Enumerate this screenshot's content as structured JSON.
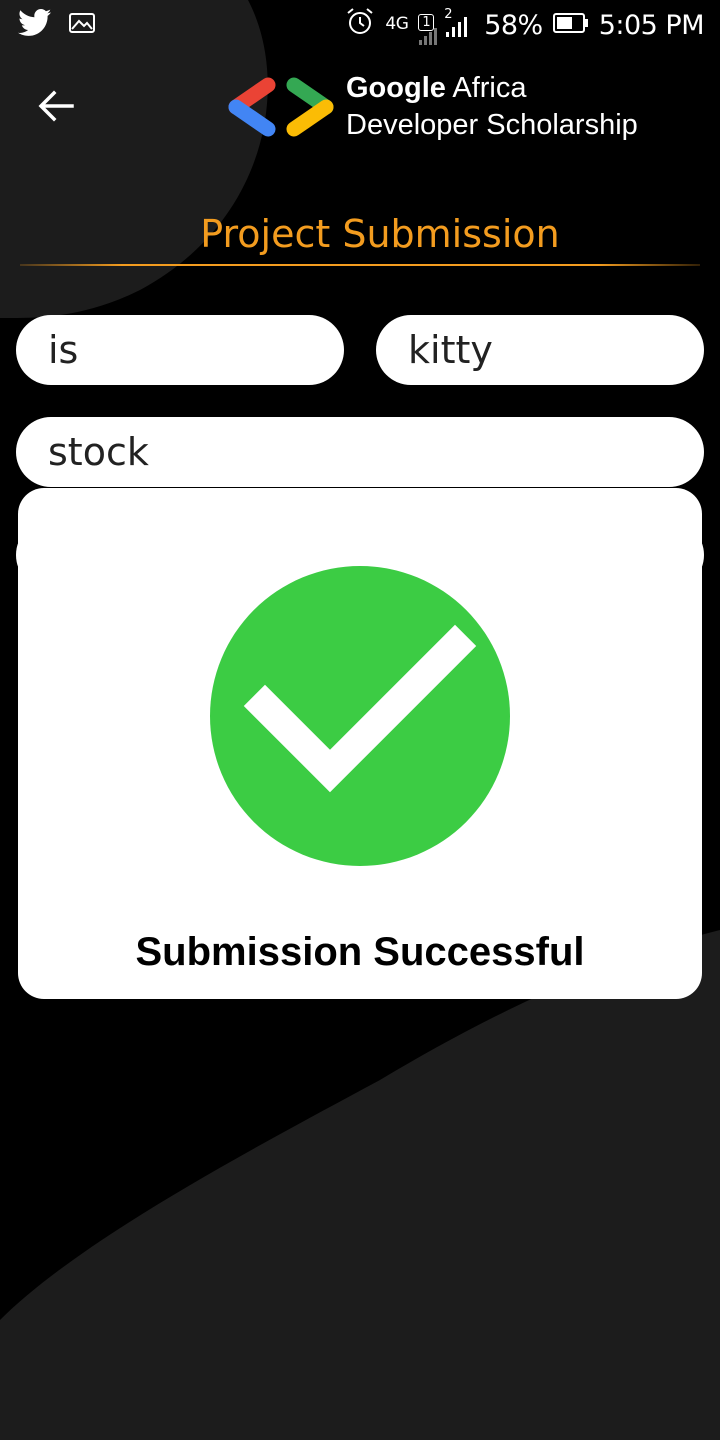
{
  "status_bar": {
    "network_type": "4G",
    "sim1": "1",
    "sim2": "2",
    "battery_percent": "58%",
    "time": "5:05 PM",
    "icons": [
      "twitter-icon",
      "gallery-icon",
      "alarm-icon",
      "signal-icon",
      "battery-icon"
    ]
  },
  "header": {
    "logo_brand": "Google",
    "logo_word2": "Africa",
    "logo_line2": "Developer Scholarship",
    "back_icon": "arrow-left-icon"
  },
  "page": {
    "title": "Project Submission"
  },
  "form": {
    "first_name": "is",
    "last_name": "kitty",
    "email": "stock",
    "github_link": ""
  },
  "dialog": {
    "icon": "check-circle-icon",
    "message": "Submission Successful"
  },
  "colors": {
    "background": "#000000",
    "accent": "#f39c1f",
    "success": "#3ccc44",
    "card": "#ffffff",
    "logo_red": "#ea4335",
    "logo_blue": "#4285f4",
    "logo_green": "#34a853",
    "logo_yellow": "#fbbc05"
  }
}
